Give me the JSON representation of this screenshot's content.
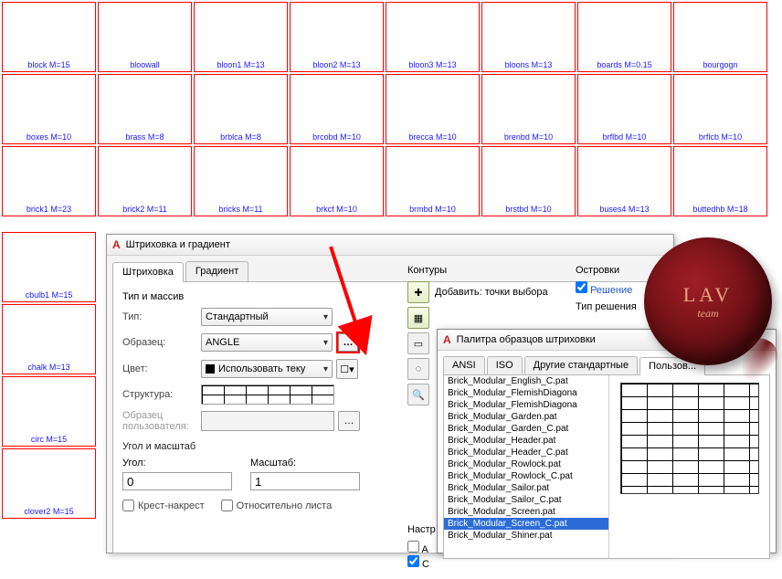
{
  "swatches_row1": [
    {
      "name": "block",
      "m": "M=15",
      "pat": "pat-brick"
    },
    {
      "name": "bloowall",
      "m": "",
      "pat": "pat-vert"
    },
    {
      "name": "bloon1",
      "m": "M=13",
      "pat": "pat-dots"
    },
    {
      "name": "bloon2",
      "m": "M=13",
      "pat": "pat-dots"
    },
    {
      "name": "bloon3",
      "m": "M=13",
      "pat": "pat-dots"
    },
    {
      "name": "bloons",
      "m": "M=13",
      "pat": "pat-dots"
    },
    {
      "name": "boards",
      "m": "M=0.15",
      "pat": "pat-vert"
    },
    {
      "name": "bourgogn",
      "m": "",
      "pat": "pat-brick"
    }
  ],
  "swatches_row2": [
    {
      "name": "boxes",
      "m": "M=10",
      "pat": "pat-squares"
    },
    {
      "name": "brass",
      "m": "M=8",
      "pat": "pat-diag"
    },
    {
      "name": "brblca",
      "m": "M=8",
      "pat": "pat-diag"
    },
    {
      "name": "brcobd",
      "m": "M=10",
      "pat": "pat-rand"
    },
    {
      "name": "brecca",
      "m": "M=10",
      "pat": "pat-rand"
    },
    {
      "name": "brenbd",
      "m": "M=10",
      "pat": "pat-brick"
    },
    {
      "name": "brflbd",
      "m": "M=10",
      "pat": "pat-brick"
    },
    {
      "name": "brflcb",
      "m": "M=10",
      "pat": "pat-brick"
    }
  ],
  "swatches_row3": [
    {
      "name": "brick1",
      "m": "M=23",
      "pat": "pat-brick"
    },
    {
      "name": "brick2",
      "m": "M=11",
      "pat": "pat-brick"
    },
    {
      "name": "bricks",
      "m": "M=11",
      "pat": "pat-brick"
    },
    {
      "name": "brkcf",
      "m": "M=10",
      "pat": "pat-diag"
    },
    {
      "name": "brmbd",
      "m": "M=10",
      "pat": "pat-brick"
    },
    {
      "name": "brstbd",
      "m": "M=10",
      "pat": "pat-rand"
    },
    {
      "name": "buses4",
      "m": "M=13",
      "pat": "pat-diag2"
    },
    {
      "name": "buttedhb",
      "m": "M=18",
      "pat": "pat-herring"
    }
  ],
  "sidebar": [
    {
      "name": "cbulb1",
      "m": "M=15",
      "pat": "pat-circles"
    },
    {
      "name": "chalk",
      "m": "M=13",
      "pat": "pat-lines"
    },
    {
      "name": "circ",
      "m": "M=15",
      "pat": "pat-circles"
    },
    {
      "name": "clover2",
      "m": "M=15",
      "pat": "pat-circles"
    }
  ],
  "dialog": {
    "title": "Штриховка и градиент",
    "tabs": {
      "hatch": "Штриховка",
      "gradient": "Градиент"
    },
    "group_type": "Тип и массив",
    "type_label": "Тип:",
    "type_value": "Стандартный",
    "pattern_label": "Образец:",
    "pattern_value": "ANGLE",
    "color_label": "Цвет:",
    "color_value": "Использовать теку",
    "structure_label": "Структура:",
    "userpat_label": "Образец пользователя:",
    "angle_scale": "Угол и масштаб",
    "angle_label": "Угол:",
    "angle_value": "0",
    "scale_label": "Масштаб:",
    "scale_value": "1",
    "cross": "Крест-накрест",
    "relative": "Относительно листа"
  },
  "right": {
    "contours": "Контуры",
    "add_points": "Добавить: точки выбора",
    "islands": "Островки",
    "solve": "Решение",
    "sol_type": "Тип решения",
    "settings": "Настр"
  },
  "palette": {
    "title": "Палитра образцов штриховки",
    "tabs": {
      "ansi": "ANSI",
      "iso": "ISO",
      "other": "Другие стандартные",
      "user": "Пользов..."
    },
    "patterns": [
      "Brick_Modular_English_C.pat",
      "Brick_Modular_FlemishDiagona",
      "Brick_Modular_FlemishDiagona",
      "Brick_Modular_Garden.pat",
      "Brick_Modular_Garden_C.pat",
      "Brick_Modular_Header.pat",
      "Brick_Modular_Header_C.pat",
      "Brick_Modular_Rowlock.pat",
      "Brick_Modular_Rowlock_C.pat",
      "Brick_Modular_Sailor.pat",
      "Brick_Modular_Sailor_C.pat",
      "Brick_Modular_Screen.pat",
      "Brick_Modular_Screen_C.pat",
      "Brick_Modular_Shiner.pat"
    ],
    "selected_index": 12
  },
  "seal": {
    "line1": "LAV",
    "line2": "team"
  }
}
